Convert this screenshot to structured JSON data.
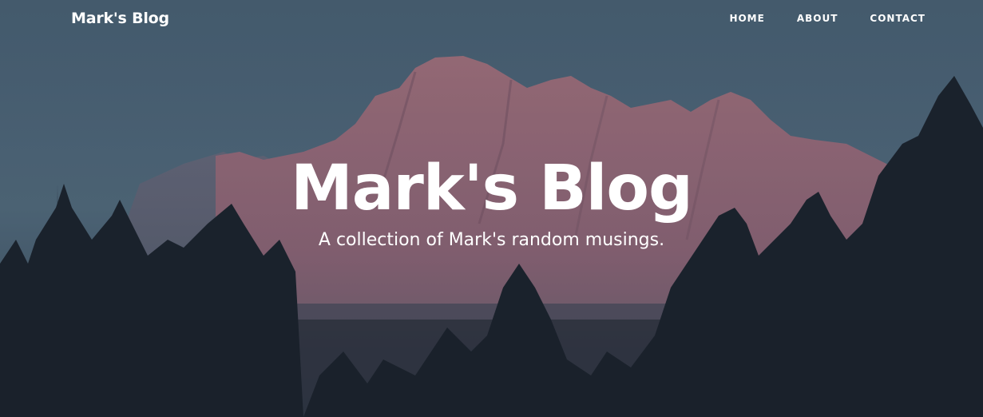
{
  "nav": {
    "brand": "Mark's Blog",
    "links": [
      {
        "label": "HOME"
      },
      {
        "label": "ABOUT"
      },
      {
        "label": "CONTACT"
      }
    ]
  },
  "hero": {
    "title": "Mark's Blog",
    "subtitle": "A collection of Mark's random musings.",
    "background_image": "mountain-forest-sunset-photo"
  },
  "colors": {
    "sky": "#4f6a7c",
    "mountain": "#9a6a7a",
    "trees": "#1c2530",
    "text": "#ffffff"
  }
}
